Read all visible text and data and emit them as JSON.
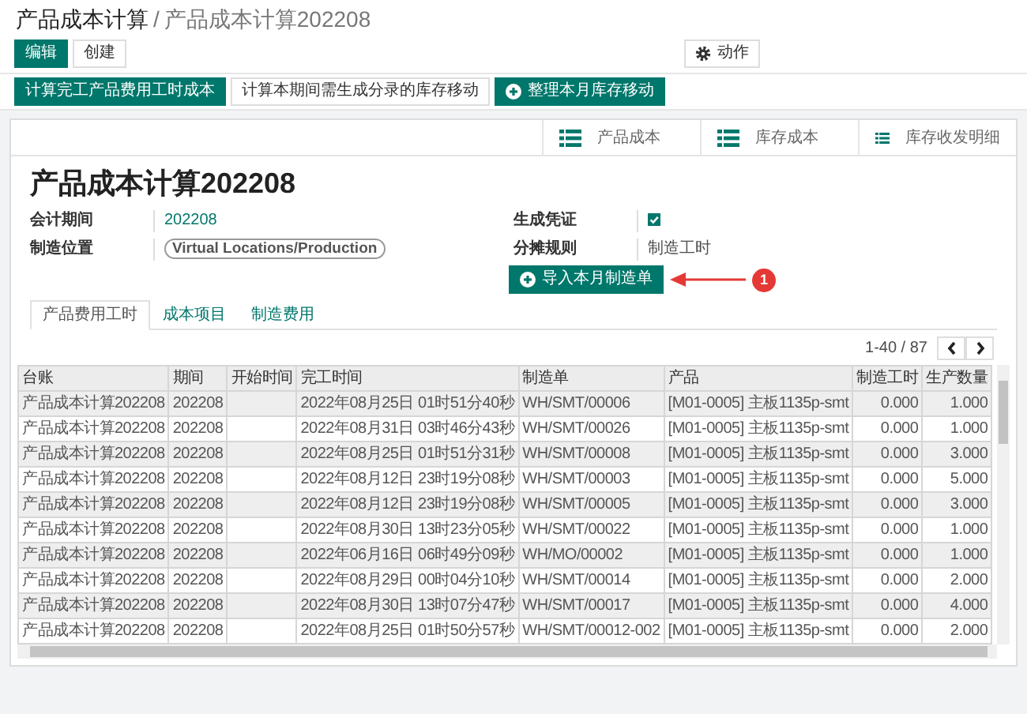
{
  "breadcrumb": {
    "parent": "产品成本计算",
    "separator": "/",
    "current": "产品成本计算202208"
  },
  "buttons": [
    {
      "label": "编辑",
      "kind": "primary"
    },
    {
      "label": "创建",
      "kind": "secondary"
    }
  ],
  "action_menu": {
    "label": "动作"
  },
  "header_buttons": [
    {
      "label": "计算完工产品费用工时成本",
      "kind": "primary"
    },
    {
      "label": "计算本期间需生成分录的库存移动",
      "kind": "secondary"
    },
    {
      "label": "整理本月库存移动",
      "kind": "primary_add"
    }
  ],
  "smart_buttons": [
    "产品成本",
    "库存成本",
    "库存收发明细"
  ],
  "title": "产品成本计算202208",
  "fields_left": [
    {
      "label": "会计期间",
      "value": "202208",
      "kind": "link"
    },
    {
      "label": "制造位置",
      "value": "Virtual Locations/Production",
      "kind": "tag"
    }
  ],
  "fields_right": [
    {
      "label": "生成凭证",
      "kind": "checkbox",
      "checked": true
    },
    {
      "label": "分摊规则",
      "value": "制造工时",
      "kind": "text"
    }
  ],
  "import_button": "导入本月制造单",
  "annotation": {
    "badge": "1"
  },
  "tabs": [
    {
      "label": "产品费用工时",
      "selected": true
    },
    {
      "label": "成本项目",
      "selected": false
    },
    {
      "label": "制造费用",
      "selected": false
    }
  ],
  "pager": {
    "range": "1-40 / 87"
  },
  "table": {
    "columns": [
      {
        "label": "台账",
        "kind": "text"
      },
      {
        "label": "期间",
        "kind": "text"
      },
      {
        "label": "开始时间",
        "kind": "text"
      },
      {
        "label": "完工时间",
        "kind": "text"
      },
      {
        "label": "制造单",
        "kind": "text"
      },
      {
        "label": "产品",
        "kind": "text"
      },
      {
        "label": "制造工时",
        "kind": "number"
      },
      {
        "label": "生产数量",
        "kind": "number"
      }
    ],
    "rows": [
      [
        "产品成本计算202208",
        "202208",
        "",
        "2022年08月25日 01时51分40秒",
        "WH/SMT/00006",
        "[M01-0005] 主板1135p-smt",
        "0.000",
        "1.000"
      ],
      [
        "产品成本计算202208",
        "202208",
        "",
        "2022年08月31日 03时46分43秒",
        "WH/SMT/00026",
        "[M01-0005] 主板1135p-smt",
        "0.000",
        "1.000"
      ],
      [
        "产品成本计算202208",
        "202208",
        "",
        "2022年08月25日 01时51分31秒",
        "WH/SMT/00008",
        "[M01-0005] 主板1135p-smt",
        "0.000",
        "3.000"
      ],
      [
        "产品成本计算202208",
        "202208",
        "",
        "2022年08月12日 23时19分08秒",
        "WH/SMT/00003",
        "[M01-0005] 主板1135p-smt",
        "0.000",
        "5.000"
      ],
      [
        "产品成本计算202208",
        "202208",
        "",
        "2022年08月12日 23时19分08秒",
        "WH/SMT/00005",
        "[M01-0005] 主板1135p-smt",
        "0.000",
        "3.000"
      ],
      [
        "产品成本计算202208",
        "202208",
        "",
        "2022年08月30日 13时23分05秒",
        "WH/SMT/00022",
        "[M01-0005] 主板1135p-smt",
        "0.000",
        "1.000"
      ],
      [
        "产品成本计算202208",
        "202208",
        "",
        "2022年06月16日 06时49分09秒",
        "WH/MO/00002",
        "[M01-0005] 主板1135p-smt",
        "0.000",
        "1.000"
      ],
      [
        "产品成本计算202208",
        "202208",
        "",
        "2022年08月29日 00时04分10秒",
        "WH/SMT/00014",
        "[M01-0005] 主板1135p-smt",
        "0.000",
        "2.000"
      ],
      [
        "产品成本计算202208",
        "202208",
        "",
        "2022年08月30日 13时07分47秒",
        "WH/SMT/00017",
        "[M01-0005] 主板1135p-smt",
        "0.000",
        "4.000"
      ],
      [
        "产品成本计算202208",
        "202208",
        "",
        "2022年08月25日 01时50分57秒",
        "WH/SMT/00012-002",
        "[M01-0005] 主板1135p-smt",
        "0.000",
        "2.000"
      ]
    ]
  }
}
